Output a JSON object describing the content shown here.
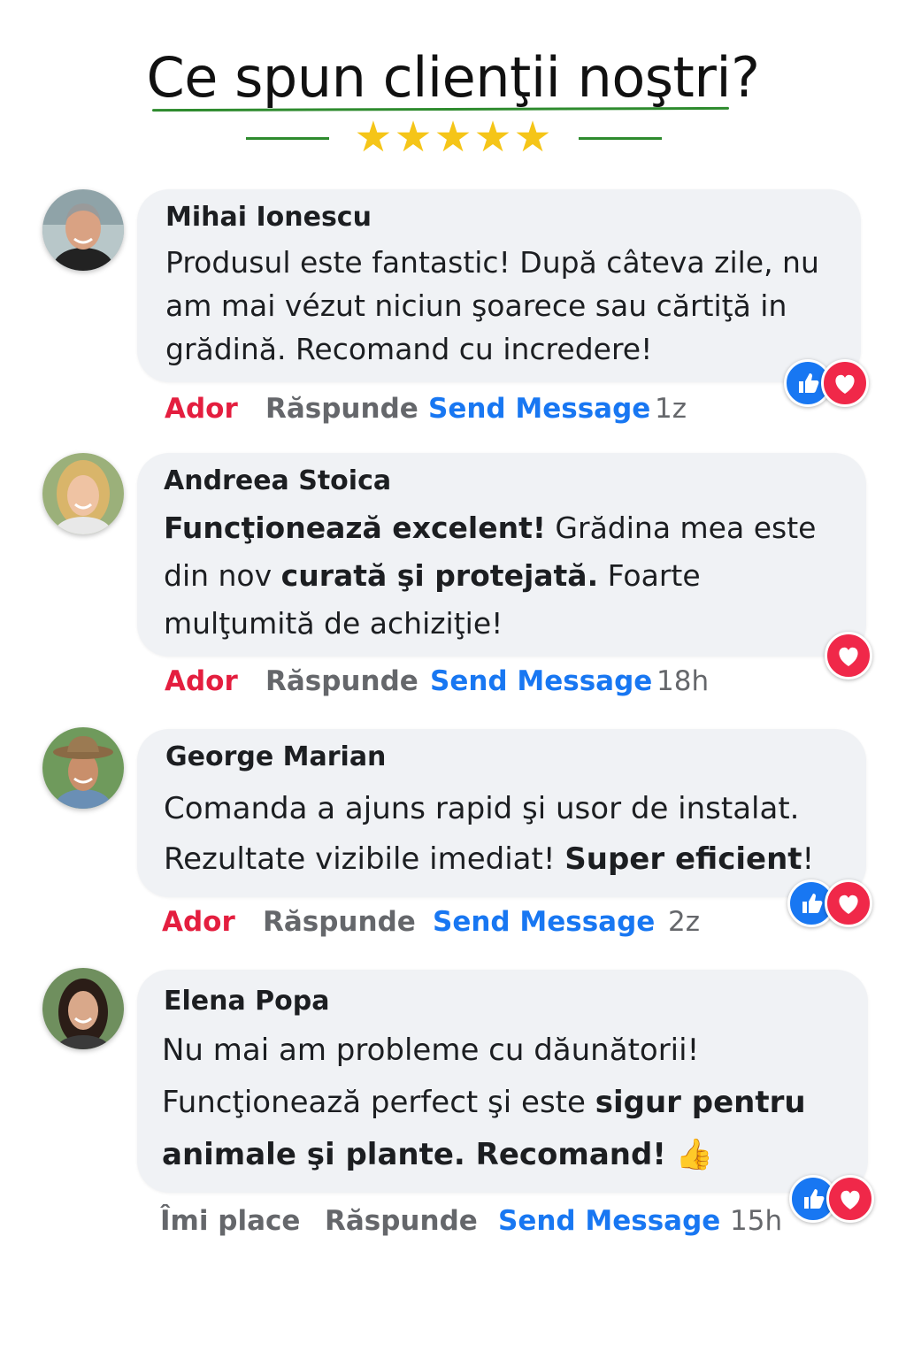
{
  "header": {
    "title": "Ce spun clienţii noştri?",
    "stars": "★★★★★"
  },
  "colors": {
    "accent_green": "#2e8b2e",
    "star": "#f5c518",
    "love": "#e41e3f",
    "link": "#1877f2",
    "muted": "#65676b",
    "bubble": "#f0f2f5"
  },
  "comments": [
    {
      "author": "Mihai Ionescu",
      "text_parts": [
        "Produsul este fantastic! După câteva zile, nu am mai vézut niciun şoarece sau cărtiţă in grădină. Recomand cu incredere!"
      ],
      "action_react": "Ador",
      "action_reply": "Răspunde",
      "action_send": "Send Message",
      "time": "1z",
      "reactions": [
        "like-icon",
        "heart-icon"
      ]
    },
    {
      "author": "Andreea Stoica",
      "text_parts": [
        "Funcţionează excelent!",
        " Grădina mea este din nov ",
        "curată şi protejată.",
        " Foarte mulţumită de achiziţie!"
      ],
      "action_react": "Ador",
      "action_reply": "Răspunde",
      "action_send": "Send Message",
      "time": "18h",
      "reactions": [
        "heart-icon"
      ]
    },
    {
      "author": "George Marian",
      "text_parts": [
        "Comanda a ajuns rapid şi usor de instalat. Rezultate vizibile imediat! ",
        "Super eficient",
        "!"
      ],
      "action_react": "Ador",
      "action_reply": "Răspunde",
      "action_send": "Send Message",
      "time": "2z",
      "reactions": [
        "like-icon",
        "heart-icon"
      ]
    },
    {
      "author": "Elena Popa",
      "text_parts": [
        "Nu mai am probleme cu dăunătorii! Funcţionează perfect şi este ",
        "sigur pentru animale şi plante. Recomand!",
        " 👍"
      ],
      "action_react": "Îmi place",
      "action_reply": "Răspunde",
      "action_send": "Send Message",
      "time": "15h",
      "reactions": [
        "like-icon",
        "heart-icon"
      ]
    }
  ]
}
